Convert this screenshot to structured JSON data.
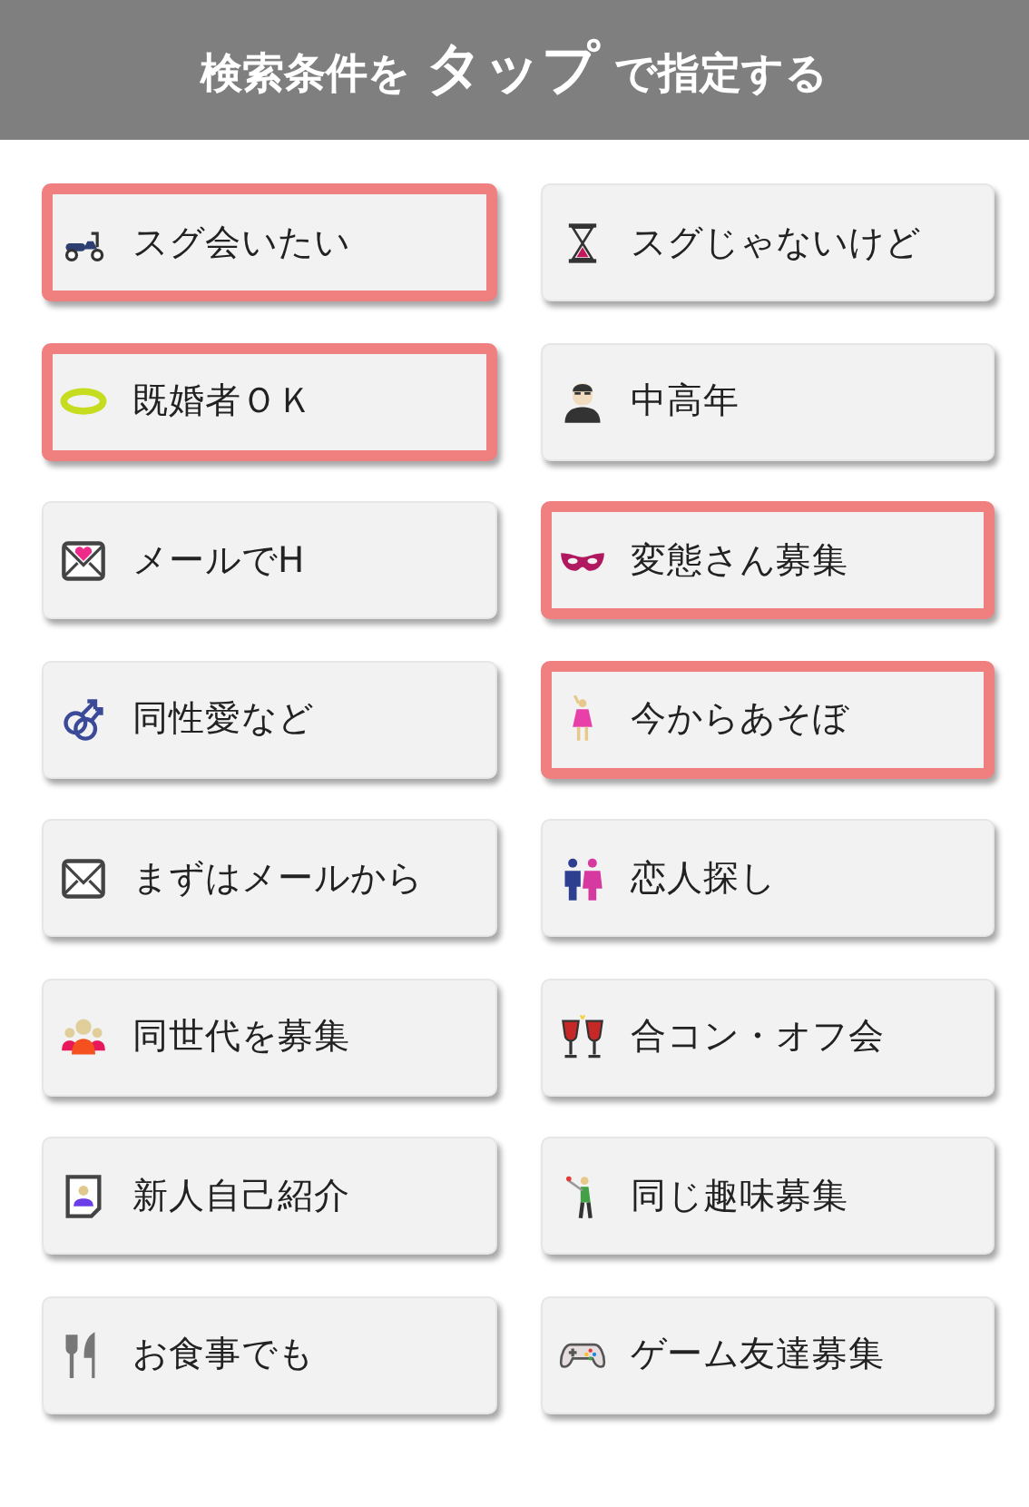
{
  "header": {
    "parts": [
      {
        "text": "検索条件を",
        "emphasis": false
      },
      {
        "text": "タップ",
        "emphasis": true
      },
      {
        "text": "で指定する",
        "emphasis": false
      }
    ]
  },
  "options": [
    {
      "label": "スグ会いたい",
      "kind": "scooter",
      "selected": true
    },
    {
      "label": "スグじゃないけど",
      "kind": "hourglass",
      "selected": false
    },
    {
      "label": "既婚者ＯＫ",
      "kind": "ring",
      "selected": true
    },
    {
      "label": "中高年",
      "kind": "man",
      "selected": false
    },
    {
      "label": "メールでH",
      "kind": "heartmail",
      "selected": false
    },
    {
      "label": "変態さん募集",
      "kind": "mask",
      "selected": true
    },
    {
      "label": "同性愛など",
      "kind": "gender",
      "selected": false
    },
    {
      "label": "今からあそぼ",
      "kind": "woman",
      "selected": true
    },
    {
      "label": "まずはメールから",
      "kind": "mail",
      "selected": false
    },
    {
      "label": "恋人探し",
      "kind": "couple",
      "selected": false
    },
    {
      "label": "同世代を募集",
      "kind": "group",
      "selected": false
    },
    {
      "label": "合コン・オフ会",
      "kind": "wine",
      "selected": false
    },
    {
      "label": "新人自己紹介",
      "kind": "profile",
      "selected": false
    },
    {
      "label": "同じ趣味募集",
      "kind": "golfer",
      "selected": false
    },
    {
      "label": "お食事でも",
      "kind": "cutlery",
      "selected": false
    },
    {
      "label": "ゲーム友達募集",
      "kind": "gamepad",
      "selected": false
    }
  ]
}
